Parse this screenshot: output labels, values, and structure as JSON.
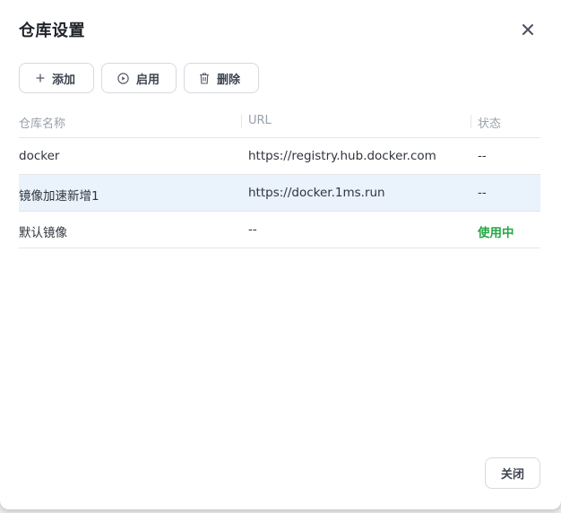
{
  "dialog": {
    "title": "仓库设置",
    "close_icon": "close-icon"
  },
  "toolbar": {
    "add_label": "添加",
    "enable_label": "启用",
    "delete_label": "删除"
  },
  "table": {
    "headers": [
      "仓库名称",
      "URL",
      "状态"
    ],
    "rows": [
      {
        "name": "docker",
        "url": "https://registry.hub.docker.com",
        "status": "--"
      },
      {
        "name": "镜像加速新增1",
        "url": "https://docker.1ms.run",
        "status": "--"
      },
      {
        "name": "默认镜像",
        "url": "--",
        "status": "使用中"
      }
    ],
    "selected_row": 1
  },
  "footer": {
    "close_label": "关闭"
  },
  "colors": {
    "status_active": "#27a644",
    "selected_row_bg": "#eaf2fc"
  }
}
